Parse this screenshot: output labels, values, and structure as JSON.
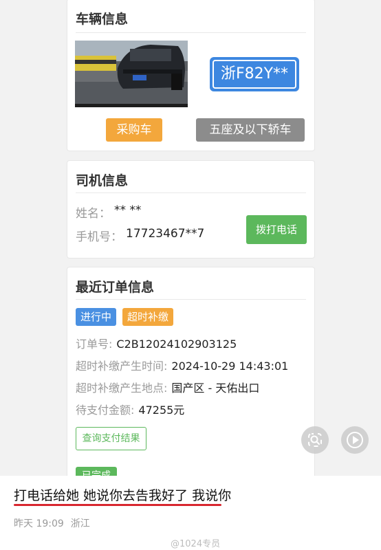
{
  "vehicle_card": {
    "title": "车辆信息",
    "plate": "浙F82Y**",
    "purchase_label": "采购车",
    "car_type_label": "五座及以下轿车"
  },
  "driver_card": {
    "title": "司机信息",
    "name_label": "姓名：",
    "name_value": "** **",
    "phone_label": "手机号：",
    "phone_value": "17723467**7",
    "call_button": "拨打电话"
  },
  "order_card": {
    "title": "最近订单信息",
    "status_tag": "进行中",
    "overtime_tag": "超时补缴",
    "order_no_label": "订单号:",
    "order_no_value": "C2B12024102903125",
    "time_label": "超时补缴产生时间:",
    "time_value": "2024-10-29 14:43:01",
    "place_label": "超时补缴产生地点:",
    "place_value": "国产区 - 天佑出口",
    "amount_label": "待支付金额:",
    "amount_value": "47255元",
    "query_button": "查询支付结果",
    "done_tag": "已完成"
  },
  "post": {
    "caption": "打电话给她  她说你去告我好了  我说你",
    "time": "昨天 19:09",
    "location": "浙江",
    "watermark": "@1024专员"
  },
  "colors": {
    "blue": "#4a90e2",
    "orange": "#f3a73c",
    "green": "#5cb85c",
    "gray": "#8c8c8c",
    "red_underline": "#d8262f"
  },
  "icons": {
    "lens": "lens-icon",
    "play": "play-icon"
  }
}
